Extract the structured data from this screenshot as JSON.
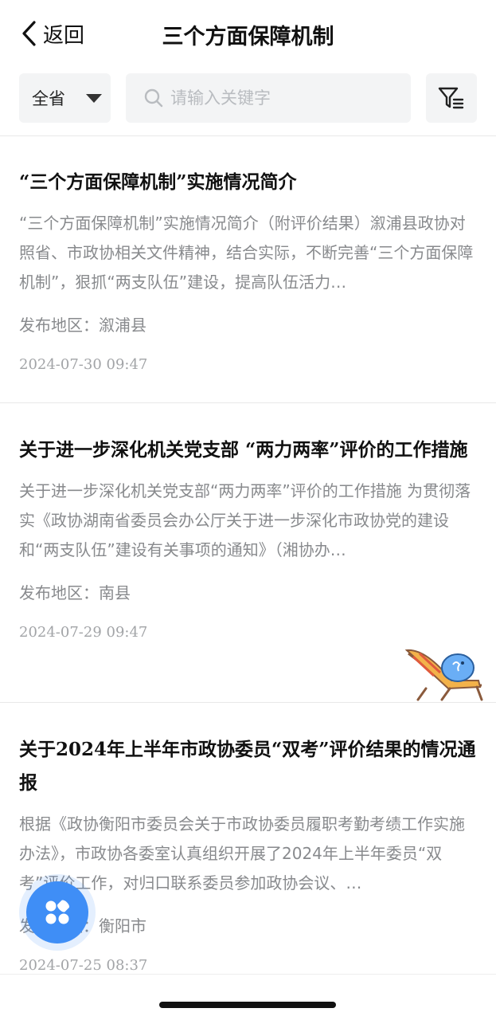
{
  "header": {
    "back_label": "返回",
    "title": "三个方面保障机制"
  },
  "filter": {
    "region_label": "全省",
    "search_placeholder": "请输入关键字"
  },
  "region_prefix": "发布地区：",
  "items": [
    {
      "title": "“三个方面保障机制”实施情况简介",
      "summary": "“三个方面保障机制”实施情况简介（附评价结果）溆浦县政协对照省、市政协相关文件精神，结合实际，不断完善“三个方面保障机制”，狠抓“两支队伍”建设，提高队伍活力…",
      "region": "发布地区：溆浦县",
      "date": "2024-07-30 09:47"
    },
    {
      "title": "关于进一步深化机关党支部 “两力两率”评价的工作措施",
      "summary": "关于进一步深化机关党支部“两力两率”评价的工作措施 为贯彻落实《政协湖南省委员会办公厅关于进一步深化市政协党的建设和“两支队伍”建设有关事项的通知》（湘协办…",
      "region": "发布地区：南县",
      "date": "2024-07-29 09:47"
    },
    {
      "title": "关于2024年上半年市政协委员“双考”评价结果的情况通报",
      "summary": "根据《政协衡阳市委员会关于市政协委员履职考勤考绩工作实施办法》，市政协各委室认真组织开展了2024年上半年委员“双考”评价工作，对归口联系委员参加政协会议、…",
      "region": "发布地区：衡阳市",
      "date": "2024-07-25 08:37"
    }
  ],
  "icons": {
    "back": "chevron-left-icon",
    "dropdown": "triangle-down-icon",
    "search": "search-icon",
    "filter": "filter-list-icon",
    "fab": "apps-grid-icon"
  },
  "colors": {
    "accent": "#3f8ef6",
    "muted_text": "#888a8d",
    "input_bg": "#f3f4f5"
  }
}
